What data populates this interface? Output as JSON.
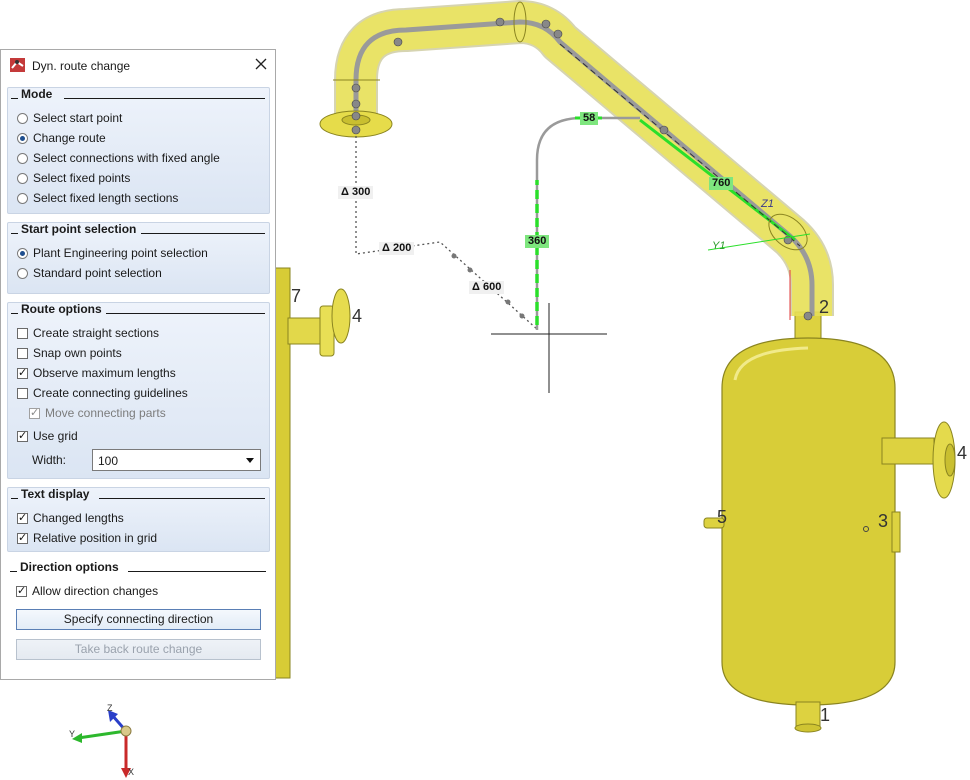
{
  "dialog": {
    "title": "Dyn. route change",
    "groups": {
      "mode": {
        "title": "Mode",
        "options": [
          {
            "label": "Select start point",
            "selected": false
          },
          {
            "label": "Change route",
            "selected": true
          },
          {
            "label": "Select connections with fixed angle",
            "selected": false
          },
          {
            "label": "Select fixed points",
            "selected": false
          },
          {
            "label": "Select fixed length sections",
            "selected": false
          }
        ]
      },
      "start_point": {
        "title": "Start point selection",
        "options": [
          {
            "label": "Plant Engineering point selection",
            "selected": true
          },
          {
            "label": "Standard point selection",
            "selected": false
          }
        ]
      },
      "route_options": {
        "title": "Route options",
        "checks": [
          {
            "label": "Create straight sections",
            "checked": false
          },
          {
            "label": "Snap own points",
            "checked": false
          },
          {
            "label": "Observe maximum lengths",
            "checked": true
          },
          {
            "label": "Create connecting guidelines",
            "checked": false
          },
          {
            "label": "Move connecting parts",
            "checked": true,
            "disabled": true
          },
          {
            "label": "Use grid",
            "checked": true
          }
        ],
        "width_label": "Width:",
        "width_value": "100"
      },
      "text_display": {
        "title": "Text display",
        "checks": [
          {
            "label": "Changed lengths",
            "checked": true
          },
          {
            "label": "Relative position in grid",
            "checked": true
          }
        ]
      },
      "direction": {
        "title": "Direction options",
        "checks": [
          {
            "label": "Allow direction changes",
            "checked": true
          }
        ],
        "specify_button": "Specify connecting direction",
        "takeback_button": "Take back route change"
      }
    }
  },
  "viewport": {
    "measure_labels": {
      "d300": "Δ 300",
      "d200": "Δ 200",
      "d600": "Δ 600",
      "g58": "58",
      "g360": "360",
      "g760": "760"
    },
    "axis_labels": {
      "z1": "Z1",
      "y1": "Y1"
    },
    "connection_numbers": {
      "n7": "7",
      "n4a": "4",
      "n2": "2",
      "n4b": "4",
      "n5": "5",
      "n3": "3",
      "n1": "1"
    },
    "triad": {
      "x": "X",
      "y": "Y",
      "z": "Z"
    },
    "colors": {
      "pipe": "#e8e23c",
      "vessel": "#d4c93a",
      "guide": "#2adf2a"
    }
  }
}
